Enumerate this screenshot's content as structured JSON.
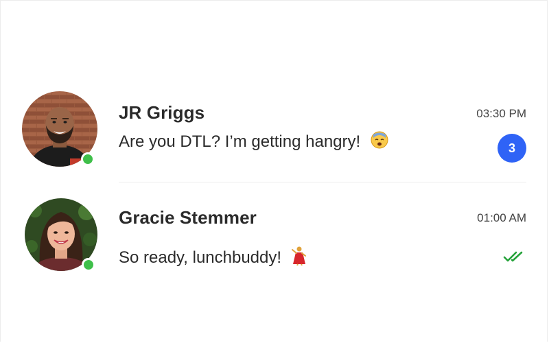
{
  "colors": {
    "accent": "#2f63f6",
    "online": "#3fbf4a",
    "read_ticks": "#25a23a",
    "divider": "#eeeeee"
  },
  "conversations": [
    {
      "name": "JR Griggs",
      "message": "Are you DTL? I’m getting hangry!",
      "emoji": "fearful-face-emoji",
      "time": "03:30 PM",
      "unread_count": "3",
      "online": true
    },
    {
      "name": "Gracie Stemmer",
      "message": "So ready, lunchbuddy!",
      "emoji": "dancer-emoji",
      "time": "01:00 AM",
      "status": "double-check-read-icon",
      "online": true
    }
  ]
}
